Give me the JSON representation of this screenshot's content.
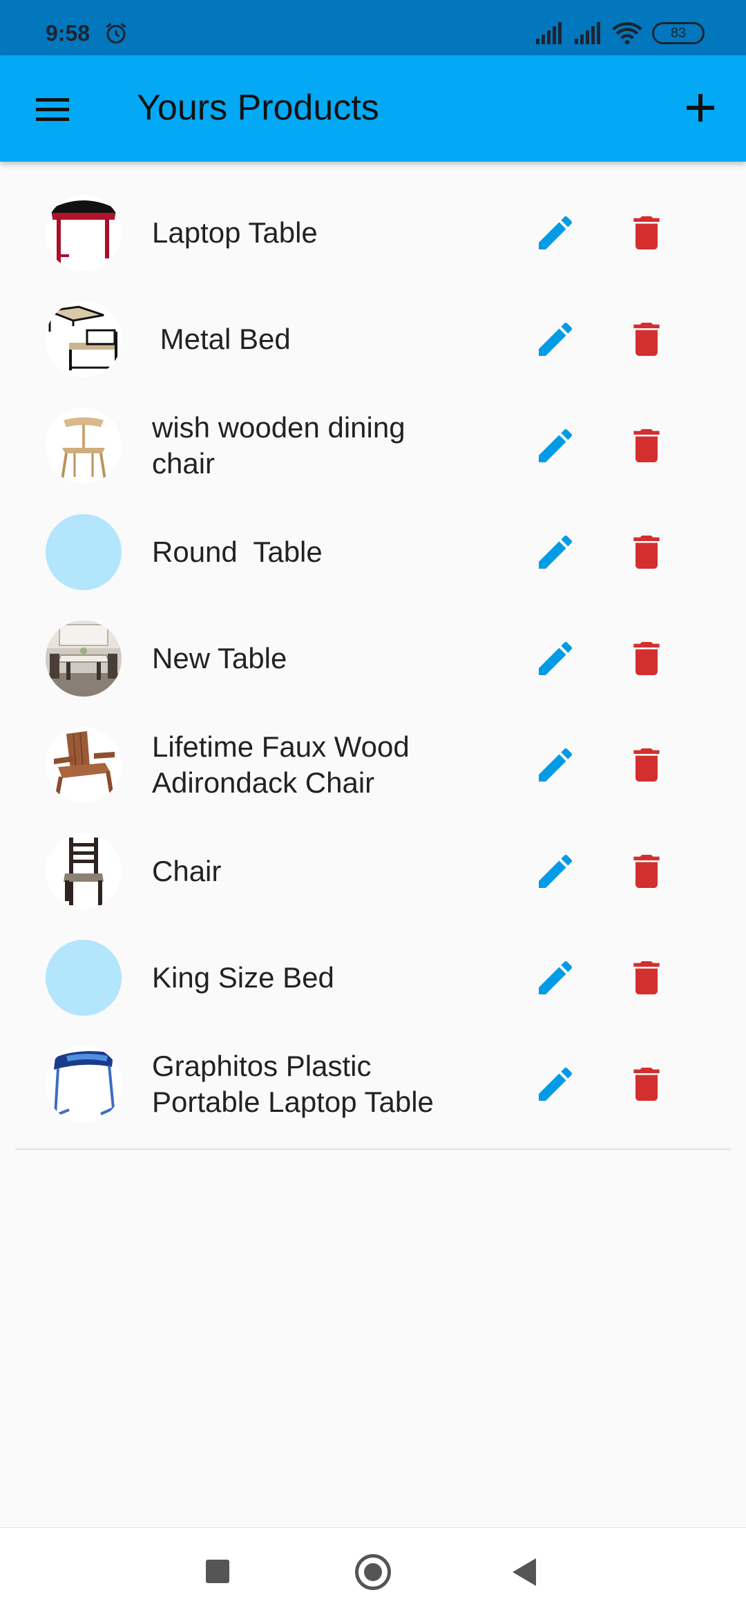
{
  "status_bar": {
    "time": "9:58",
    "battery": "83"
  },
  "app_bar": {
    "title": "Yours Products",
    "menu_icon": "menu-icon",
    "add_icon": "plus-icon"
  },
  "colors": {
    "app_bar": "#03a9f4",
    "status_bar": "#0277bd",
    "edit": "#039be5",
    "delete": "#d32f2f",
    "placeholder_avatar": "#b3e5fc"
  },
  "products": [
    {
      "name": "Laptop Table",
      "image": "laptop-table-photo"
    },
    {
      "name": " Metal Bed",
      "image": "metal-bed-photo"
    },
    {
      "name": "wish wooden dining\nchair",
      "image": "wooden-chair-photo"
    },
    {
      "name": "Round  Table",
      "image": ""
    },
    {
      "name": "New Table",
      "image": "dining-room-photo"
    },
    {
      "name": "Lifetime Faux Wood\nAdirondack Chair",
      "image": "adirondack-chair-photo"
    },
    {
      "name": "Chair",
      "image": "dark-chair-photo"
    },
    {
      "name": "King Size Bed",
      "image": ""
    },
    {
      "name": "Graphitos Plastic\nPortable Laptop Table",
      "image": "portable-table-photo"
    }
  ],
  "row_actions": {
    "edit_icon": "pencil-icon",
    "delete_icon": "trash-icon"
  }
}
